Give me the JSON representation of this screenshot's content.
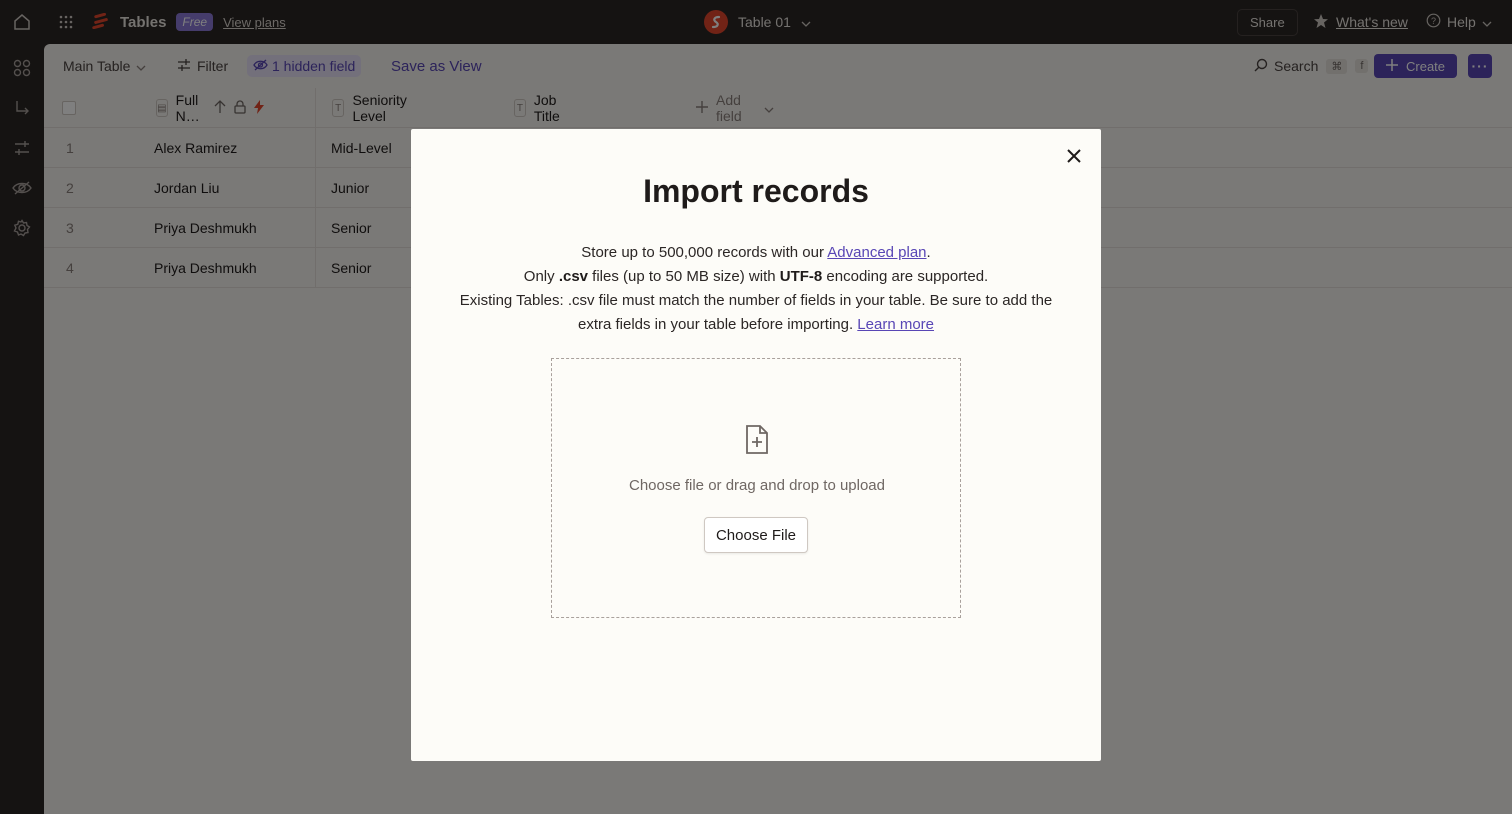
{
  "topbar": {
    "app_name": "Tables",
    "plan_badge": "Free",
    "view_plans": "View plans",
    "table_title": "Table 01",
    "share": "Share",
    "whats_new": "What's new",
    "help": "Help"
  },
  "toolbar": {
    "view_name": "Main Table",
    "filter": "Filter",
    "hidden_fields": "1 hidden field",
    "save_as_view": "Save as View",
    "search": "Search",
    "shortcut_cmd": "⌘",
    "shortcut_key": "f",
    "create": "Create"
  },
  "table": {
    "columns": [
      {
        "label": "Full N…",
        "type_icon": "id-card-icon"
      },
      {
        "label": "Seniority Level",
        "type_icon": "text-type-icon"
      },
      {
        "label": "Job Title",
        "type_icon": "text-type-icon"
      }
    ],
    "add_field": "Add field",
    "rows": [
      {
        "num": "1",
        "name": "Alex Ramirez",
        "seniority": "Mid-Level"
      },
      {
        "num": "2",
        "name": "Jordan Liu",
        "seniority": "Junior"
      },
      {
        "num": "3",
        "name": "Priya Deshmukh",
        "seniority": "Senior"
      },
      {
        "num": "4",
        "name": "Priya Deshmukh",
        "seniority": "Senior"
      }
    ]
  },
  "modal": {
    "title": "Import records",
    "line1_pre": "Store up to 500,000 records with our ",
    "line1_link": "Advanced plan",
    "line1_post": ".",
    "line2_pre": "Only ",
    "line2_b1": ".csv",
    "line2_mid": " files (up to 50 MB size) with ",
    "line2_b2": "UTF-8",
    "line2_post": " encoding are supported.",
    "line3": "Existing Tables: .csv file must match the number of fields in your table. Be sure to add the extra fields in your table before importing. ",
    "learn_more": "Learn more",
    "dropzone_text": "Choose file or drag and drop to upload",
    "choose_file": "Choose File"
  },
  "colors": {
    "accent": "#5846b5",
    "brand_red": "#e2462c",
    "topbar_bg": "#2b2625"
  }
}
